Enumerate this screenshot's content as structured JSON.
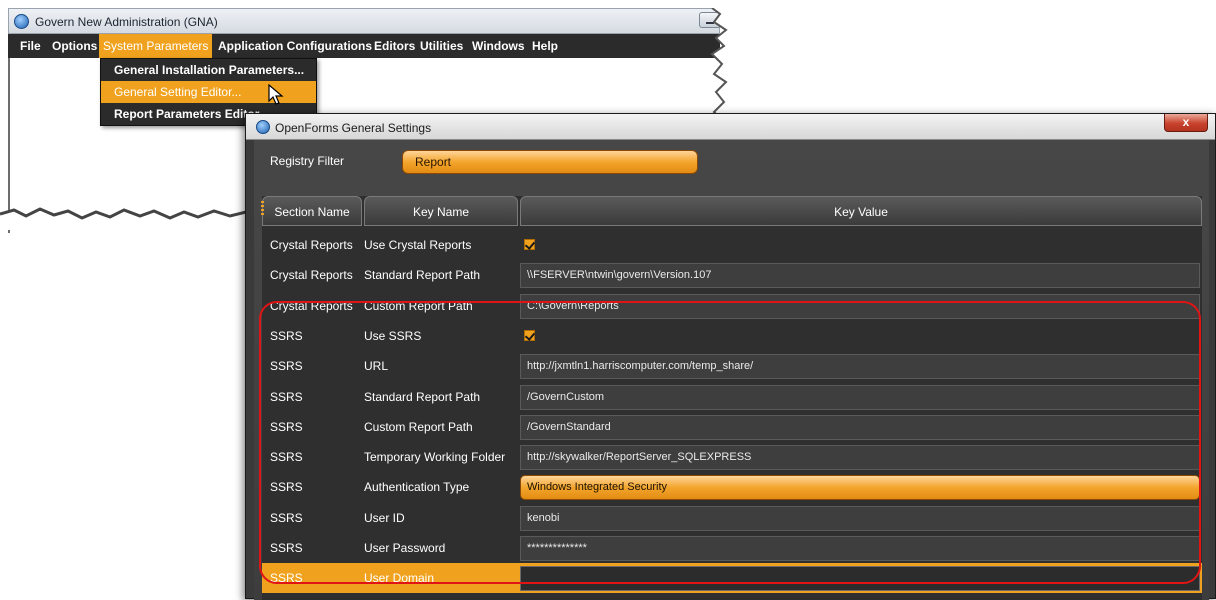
{
  "gna_window": {
    "title": "Govern New Administration (GNA)",
    "menu": [
      "File",
      "Options",
      "System Parameters",
      "Application Configurations",
      "Editors",
      "Utilities",
      "Windows",
      "Help"
    ],
    "active_menu": "System Parameters",
    "dropdown": [
      "General Installation Parameters...",
      "General Setting Editor...",
      "Report Parameters Editor..."
    ],
    "highlighted_dropdown": "General Setting Editor..."
  },
  "settings_window": {
    "title": "OpenForms General Settings",
    "close_label": "x",
    "filter_label": "Registry Filter",
    "filter_value": "Report",
    "columns": [
      "Section Name",
      "Key Name",
      "Key Value"
    ],
    "rows": [
      {
        "section": "Crystal Reports",
        "key": "Use Crystal Reports",
        "value": "",
        "kind": "checkbox",
        "checked": true
      },
      {
        "section": "Crystal Reports",
        "key": "Standard Report Path",
        "value": "\\\\FSERVER\\ntwin\\govern\\Version.107",
        "kind": "text"
      },
      {
        "section": "Crystal Reports",
        "key": "Custom Report Path",
        "value": "C:\\Govern\\Reports",
        "kind": "text"
      },
      {
        "section": "SSRS",
        "key": "Use SSRS",
        "value": "",
        "kind": "checkbox",
        "checked": true
      },
      {
        "section": "SSRS",
        "key": "URL",
        "value": "http://jxmtln1.harriscomputer.com/temp_share/",
        "kind": "text"
      },
      {
        "section": "SSRS",
        "key": "Standard Report Path",
        "value": "/GovernCustom",
        "kind": "text"
      },
      {
        "section": "SSRS",
        "key": "Custom Report Path",
        "value": "/GovernStandard",
        "kind": "text"
      },
      {
        "section": "SSRS",
        "key": "Temporary Working Folder",
        "value": "http://skywalker/ReportServer_SQLEXPRESS",
        "kind": "text"
      },
      {
        "section": "SSRS",
        "key": "Authentication Type",
        "value": "Windows Integrated Security",
        "kind": "dropdown"
      },
      {
        "section": "SSRS",
        "key": "User ID",
        "value": "kenobi",
        "kind": "text"
      },
      {
        "section": "SSRS",
        "key": "User Password",
        "value": "**************",
        "kind": "text"
      },
      {
        "section": "SSRS",
        "key": "User Domain",
        "value": "",
        "kind": "text",
        "selected": true
      }
    ]
  },
  "colors": {
    "accent": "#f0a21e",
    "dark_bg": "#3a3a3a",
    "highlight_border": "#e01414"
  }
}
